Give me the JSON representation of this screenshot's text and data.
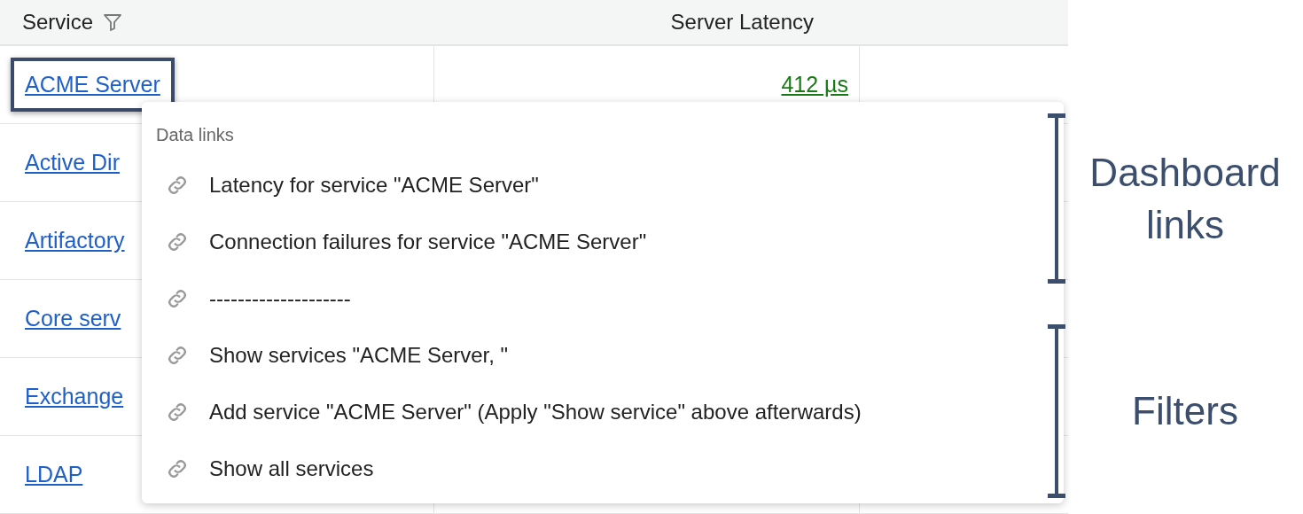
{
  "table": {
    "columns": [
      {
        "label": "Service",
        "filter": true
      },
      {
        "label": "Server Latency"
      }
    ],
    "rows": [
      {
        "service": "ACME Server",
        "latency": "412 µs",
        "highlighted": true
      },
      {
        "service": "Active Dir",
        "highlighted": false
      },
      {
        "service": "Artifactory",
        "highlighted": false
      },
      {
        "service": "Core serv",
        "highlighted": false
      },
      {
        "service": "Exchange",
        "highlighted": false
      },
      {
        "service": "LDAP",
        "highlighted": false
      }
    ]
  },
  "popup": {
    "title": "Data links",
    "items": [
      {
        "label": "Latency for service \"ACME Server\""
      },
      {
        "label": "Connection failures for service \"ACME Server\""
      },
      {
        "label": "--------------------"
      },
      {
        "label": "Show services \"ACME Server, \""
      },
      {
        "label": "Add service \"ACME Server\" (Apply \"Show service\" above afterwards)"
      },
      {
        "label": "Show all services"
      }
    ]
  },
  "annotations": [
    {
      "label": "Dashboard links"
    },
    {
      "label": "Filters"
    }
  ]
}
